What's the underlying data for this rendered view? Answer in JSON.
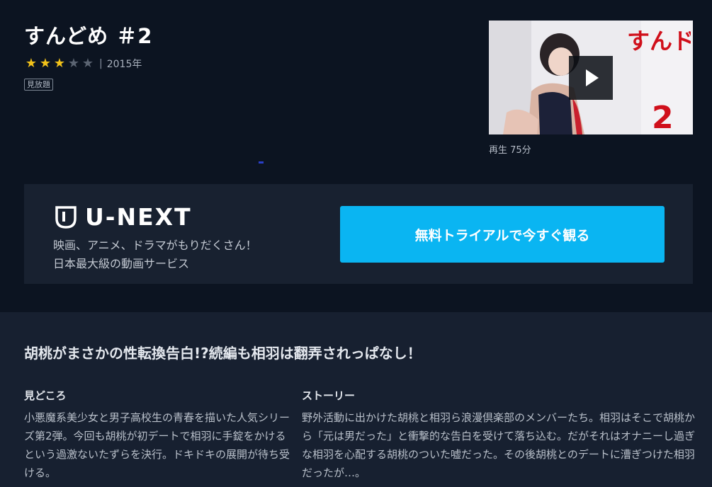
{
  "title": "すんどめ ＃2",
  "rating": {
    "value": 3,
    "max": 5
  },
  "year_sep": "|",
  "year": "2015年",
  "badge": "見放題",
  "thumbnail": {
    "logo_text": "すんドめ",
    "number_text": "2"
  },
  "play_info": "再生 75分",
  "promo": {
    "logo_text": "U-NEXT",
    "line1": "映画、アニメ、ドラマがもりだくさん！",
    "line2": "日本最大級の動画サービス",
    "cta_label": "無料トライアルで今すぐ観る"
  },
  "catchphrase": "胡桃がまさかの性転換告白!?続編も相羽は翻弄されっぱなし！",
  "highlights": {
    "heading": "見どころ",
    "body": "小悪魔系美少女と男子高校生の青春を描いた人気シリーズ第2弾。今回も胡桃が初デートで相羽に手錠をかけるという過激ないたずらを決行。ドキドキの展開が待ち受ける。"
  },
  "story": {
    "heading": "ストーリー",
    "body": "野外活動に出かけた胡桃と相羽ら浪漫倶楽部のメンバーたち。相羽はそこで胡桃から「元は男だった」と衝撃的な告白を受けて落ち込む。だがそれはオナニーし過ぎな相羽を心配する胡桃のついた嘘だった。その後胡桃とのデートに漕ぎつけた相羽だったが…。"
  },
  "colors": {
    "accent": "#0ab5f2",
    "star": "#f2c21a",
    "background": "#0c1421",
    "panel": "#182130"
  },
  "icons": [
    "star-icon",
    "play-icon",
    "unext-logo-icon"
  ]
}
